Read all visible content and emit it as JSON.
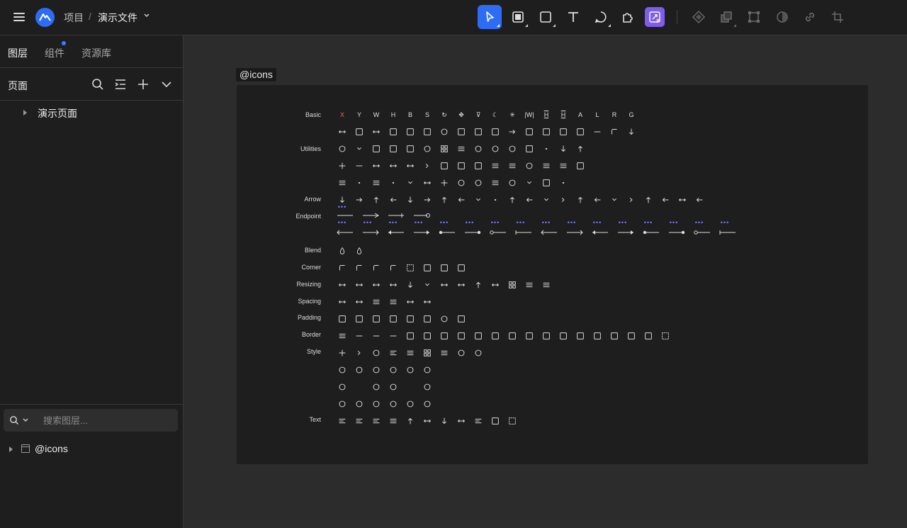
{
  "topbar": {
    "breadcrumb": {
      "project": "项目",
      "separator": "/",
      "file": "演示文件"
    },
    "tools": [
      {
        "name": "select-tool",
        "icon": "cursor-icon",
        "active": true
      },
      {
        "name": "frame-tool",
        "icon": "frame-icon"
      },
      {
        "name": "rectangle-tool",
        "icon": "rectangle-icon"
      },
      {
        "name": "text-tool",
        "icon": "text-icon"
      },
      {
        "name": "comment-tool",
        "icon": "comment-icon"
      },
      {
        "name": "component-tool",
        "icon": "puzzle-icon"
      },
      {
        "name": "plugin-tool",
        "icon": "plugin-icon"
      }
    ],
    "disabled_tools": [
      "component-diamond-icon",
      "boolean-icon",
      "vector-edit-icon",
      "mask-icon",
      "link-icon",
      "crop-icon"
    ],
    "accent": "#2f6cf6",
    "plugin_color": "#7d5cf0"
  },
  "sidebar": {
    "tabs": [
      {
        "label": "图层",
        "active": true
      },
      {
        "label": "组件",
        "dot": true
      },
      {
        "label": "资源库"
      }
    ],
    "pages_title": "页面",
    "pages": [
      {
        "label": "演示页面"
      }
    ],
    "search_placeholder": "搜索图层...",
    "layers": [
      {
        "label": "@icons"
      }
    ]
  },
  "canvas": {
    "frame_label": "@icons",
    "categories": [
      "Basic",
      "Utilities",
      "Arrow",
      "Endpoint",
      "Blend",
      "Corner",
      "Resizing",
      "Spacing",
      "Padding",
      "Border",
      "Style",
      "Text"
    ],
    "basic_letters": [
      "X",
      "Y",
      "W",
      "H",
      "B",
      "S",
      "↻",
      "✥",
      "⊽",
      "☾",
      "✳",
      "|W|",
      "H",
      "H",
      "A",
      "L",
      "R",
      "G"
    ],
    "dots": "•••"
  }
}
